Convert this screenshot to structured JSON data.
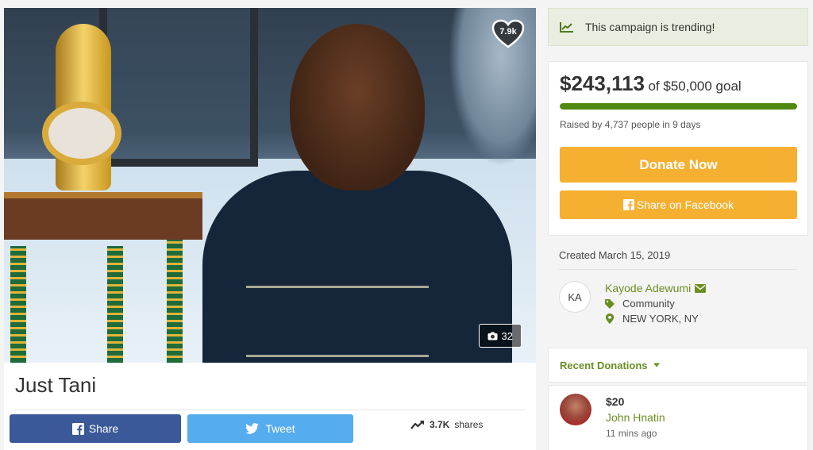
{
  "campaign": {
    "title": "Just Tani",
    "likes": "7.9k",
    "photo_count": "32"
  },
  "share_bar": {
    "facebook_label": "Share",
    "tweet_label": "Tweet",
    "share_count": "3.7K",
    "share_suffix": "shares"
  },
  "trending": {
    "label": "This campaign is trending!"
  },
  "progress": {
    "raised": "$243,113",
    "goal_text": "of $50,000 goal",
    "fraction": 1.0,
    "raised_by": "Raised by 4,737 people in 9 days"
  },
  "actions": {
    "donate_label": "Donate Now",
    "facebook_label": "Share on Facebook"
  },
  "organizer": {
    "created": "Created March 15, 2019",
    "initials": "KA",
    "name": "Kayode Adewumi",
    "category": "Community",
    "location": "NEW YORK, NY"
  },
  "recent": {
    "header": "Recent Donations",
    "items": [
      {
        "amount": "$20",
        "name": "John Hnatin",
        "time": "11 mins ago"
      }
    ]
  },
  "colors": {
    "accent_green": "#6b8e23",
    "progress_green": "#4f8a10",
    "donate_orange": "#f6b031",
    "facebook_blue": "#3b5998",
    "twitter_blue": "#55acee"
  },
  "icons": [
    "trend-chart-icon",
    "heart-icon",
    "camera-icon",
    "facebook-icon",
    "twitter-icon",
    "share-arrow-icon",
    "envelope-icon",
    "tag-icon",
    "map-marker-icon",
    "caret-down-icon"
  ]
}
